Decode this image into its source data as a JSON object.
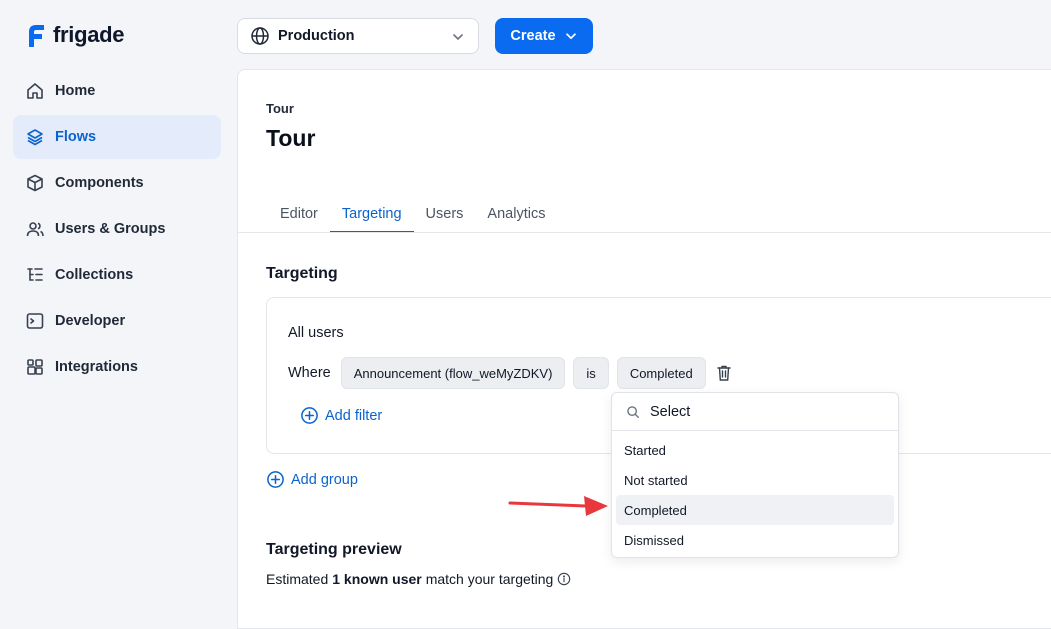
{
  "brand": {
    "name": "frigade"
  },
  "sidebar": {
    "items": [
      {
        "label": "Home",
        "icon": "home-icon"
      },
      {
        "label": "Flows",
        "icon": "layers-icon",
        "active": true
      },
      {
        "label": "Components",
        "icon": "cube-icon"
      },
      {
        "label": "Users & Groups",
        "icon": "users-icon"
      },
      {
        "label": "Collections",
        "icon": "collections-icon"
      },
      {
        "label": "Developer",
        "icon": "terminal-icon"
      },
      {
        "label": "Integrations",
        "icon": "integrations-icon"
      }
    ]
  },
  "topbar": {
    "environment": "Production",
    "create_label": "Create"
  },
  "page": {
    "breadcrumb": "Tour",
    "title": "Tour",
    "tabs": [
      {
        "label": "Editor"
      },
      {
        "label": "Targeting",
        "active": true
      },
      {
        "label": "Users"
      },
      {
        "label": "Analytics"
      }
    ]
  },
  "targeting": {
    "section_title": "Targeting",
    "group_label": "All users",
    "where_label": "Where",
    "filter": {
      "field": "Announcement (flow_weMyZDKV)",
      "operator": "is",
      "value": "Completed"
    },
    "add_filter_label": "Add filter",
    "add_group_label": "Add group"
  },
  "dropdown": {
    "search_placeholder": "Select",
    "options": [
      "Started",
      "Not started",
      "Completed",
      "Dismissed"
    ],
    "highlighted": "Completed"
  },
  "preview": {
    "title": "Targeting preview",
    "text_before": "Estimated",
    "count_text": "1 known user",
    "text_after": "match your targeting"
  },
  "colors": {
    "accent": "#0b6bf0",
    "link": "#0b63ce",
    "active_nav_bg": "#e4ecfb",
    "annotation_arrow": "#e8383d"
  }
}
